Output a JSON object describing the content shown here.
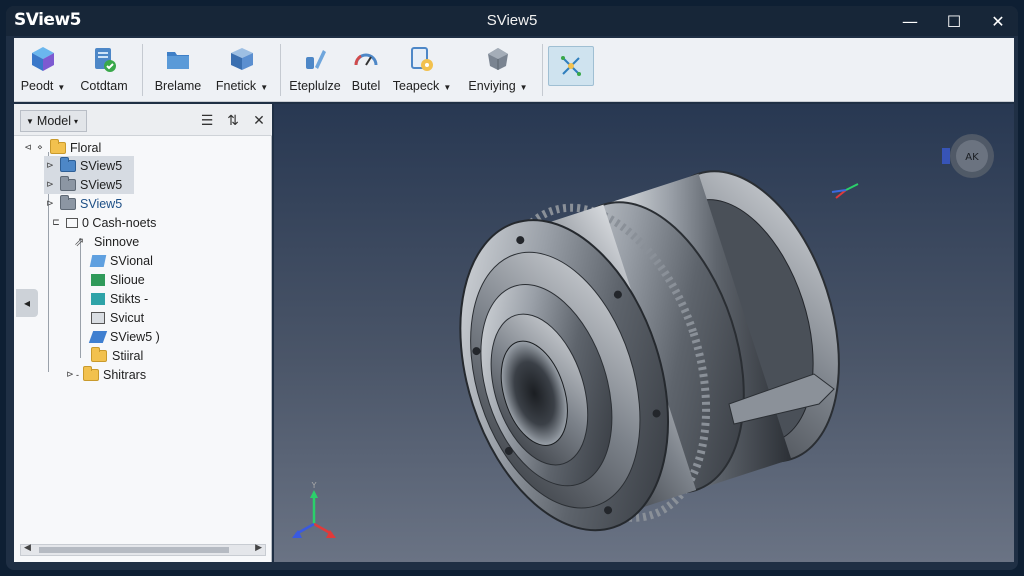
{
  "window": {
    "logo": "SView5",
    "title": "SView5",
    "controls": {
      "minimize": "—",
      "maximize": "☐",
      "close": "✕"
    }
  },
  "ribbon": {
    "items": [
      {
        "label": "Peodt",
        "icon": "cube-icon",
        "dropdown": true
      },
      {
        "label": "Cotdtam",
        "icon": "document-check-icon",
        "dropdown": false
      },
      {
        "label": "Brelame",
        "icon": "folder-icon",
        "dropdown": false
      },
      {
        "label": "Fnetick",
        "icon": "box-icon",
        "dropdown": true
      },
      {
        "label": "Eteplulze",
        "icon": "pen-icon",
        "dropdown": false
      },
      {
        "label": "Butel",
        "icon": "gauge-icon",
        "dropdown": false
      },
      {
        "label": "Teapeck",
        "icon": "document-settings-icon",
        "dropdown": true
      },
      {
        "label": "Enviying",
        "icon": "polyhedron-icon",
        "dropdown": true
      },
      {
        "label": "",
        "icon": "explode-icon",
        "dropdown": false,
        "active": true
      }
    ]
  },
  "panel": {
    "model_label": "Model",
    "tree": [
      {
        "label": "Floral",
        "icon": "folder-icon",
        "level": 0
      },
      {
        "label": "SView5",
        "icon": "folder-blue-icon",
        "level": 1,
        "selected": true
      },
      {
        "label": "SView5",
        "icon": "folder-grey-icon",
        "level": 1,
        "selected": true
      },
      {
        "label": "SView5",
        "icon": "folder-grey-icon",
        "level": 1,
        "selected": false
      },
      {
        "label": "0 Cash-noets",
        "icon": "assembly-icon",
        "level": 1
      },
      {
        "label": "Sinnove",
        "icon": "arrow-icon",
        "level": 2
      },
      {
        "label": "SVional",
        "icon": "part-blue-icon",
        "level": 3
      },
      {
        "label": "Slioue",
        "icon": "part-green-icon",
        "level": 3
      },
      {
        "label": "Stikts -",
        "icon": "part-teal-icon",
        "level": 3
      },
      {
        "label": "Svicut",
        "icon": "part-grey-icon",
        "level": 3
      },
      {
        "label": "SView5 )",
        "icon": "part-blue-icon",
        "level": 3
      },
      {
        "label": "Stiiral",
        "icon": "folder-icon",
        "level": 3
      },
      {
        "label": "Shitrars",
        "icon": "folder-icon",
        "level": 1
      }
    ]
  },
  "viewport": {
    "view_cube_label": "AK"
  }
}
